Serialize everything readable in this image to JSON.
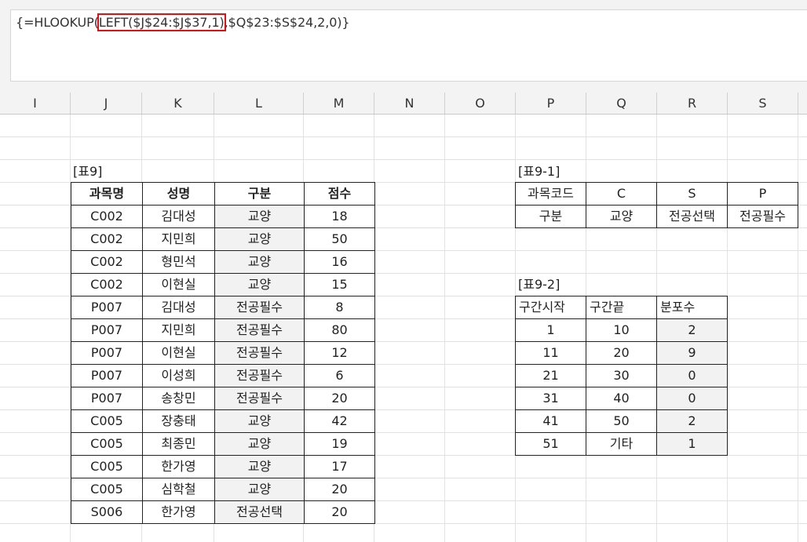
{
  "formula_bar": {
    "prefix": "{=HLOOKUP(",
    "highlighted": "LEFT($J$24:$J$37,1)",
    "suffix": ",$Q$23:$S$24,2,0)}"
  },
  "column_headers": [
    "I",
    "J",
    "K",
    "L",
    "M",
    "N",
    "O",
    "P",
    "Q",
    "R",
    "S"
  ],
  "table9": {
    "label": "[표9]",
    "headers": [
      "과목명",
      "성명",
      "구분",
      "점수"
    ],
    "rows": [
      [
        "C002",
        "김대성",
        "교양",
        "18"
      ],
      [
        "C002",
        "지민희",
        "교양",
        "50"
      ],
      [
        "C002",
        "형민석",
        "교양",
        "16"
      ],
      [
        "C002",
        "이현실",
        "교양",
        "15"
      ],
      [
        "P007",
        "김대성",
        "전공필수",
        "8"
      ],
      [
        "P007",
        "지민희",
        "전공필수",
        "80"
      ],
      [
        "P007",
        "이현실",
        "전공필수",
        "12"
      ],
      [
        "P007",
        "이성희",
        "전공필수",
        "6"
      ],
      [
        "P007",
        "송창민",
        "전공필수",
        "20"
      ],
      [
        "C005",
        "장충태",
        "교양",
        "42"
      ],
      [
        "C005",
        "최종민",
        "교양",
        "19"
      ],
      [
        "C005",
        "한가영",
        "교양",
        "17"
      ],
      [
        "C005",
        "심학철",
        "교양",
        "20"
      ],
      [
        "S006",
        "한가영",
        "전공선택",
        "20"
      ]
    ]
  },
  "table9_1": {
    "label": "[표9-1]",
    "rows": [
      [
        "과목코드",
        "C",
        "S",
        "P"
      ],
      [
        "구분",
        "교양",
        "전공선택",
        "전공필수"
      ]
    ]
  },
  "table9_2": {
    "label": "[표9-2]",
    "headers": [
      "구간시작",
      "구간끝",
      "분포수"
    ],
    "rows": [
      [
        "1",
        "10",
        "2"
      ],
      [
        "11",
        "20",
        "9"
      ],
      [
        "21",
        "30",
        "0"
      ],
      [
        "31",
        "40",
        "0"
      ],
      [
        "41",
        "50",
        "2"
      ],
      [
        "51",
        "기타",
        "1"
      ]
    ]
  }
}
